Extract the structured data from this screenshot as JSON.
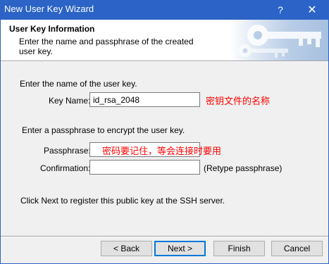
{
  "window": {
    "title": "New User Key Wizard",
    "help_glyph": "?",
    "close_glyph": "✕",
    "title_color": "#2b63c6"
  },
  "banner": {
    "title": "User Key Information",
    "description": "Enter the name and passphrase of the created user key.",
    "art_icon": "keys-icon"
  },
  "form": {
    "name_prompt": "Enter the name of the user key.",
    "key_name_label": "Key Name:",
    "key_name_value": "id_rsa_2048",
    "key_name_note": "密钥文件的名称",
    "passphrase_prompt": "Enter a passphrase to encrypt the user key.",
    "passphrase_label": "Passphrase:",
    "passphrase_value": "",
    "passphrase_note": "密码要记住，等会连接时要用",
    "confirmation_label": "Confirmation:",
    "confirmation_value": "",
    "retype_hint": "(Retype passphrase)",
    "register_text": "Click Next to register this public key at the SSH server.",
    "note_color": "#ff0000"
  },
  "buttons": {
    "back": "< Back",
    "next": "Next >",
    "finish": "Finish",
    "cancel": "Cancel"
  }
}
